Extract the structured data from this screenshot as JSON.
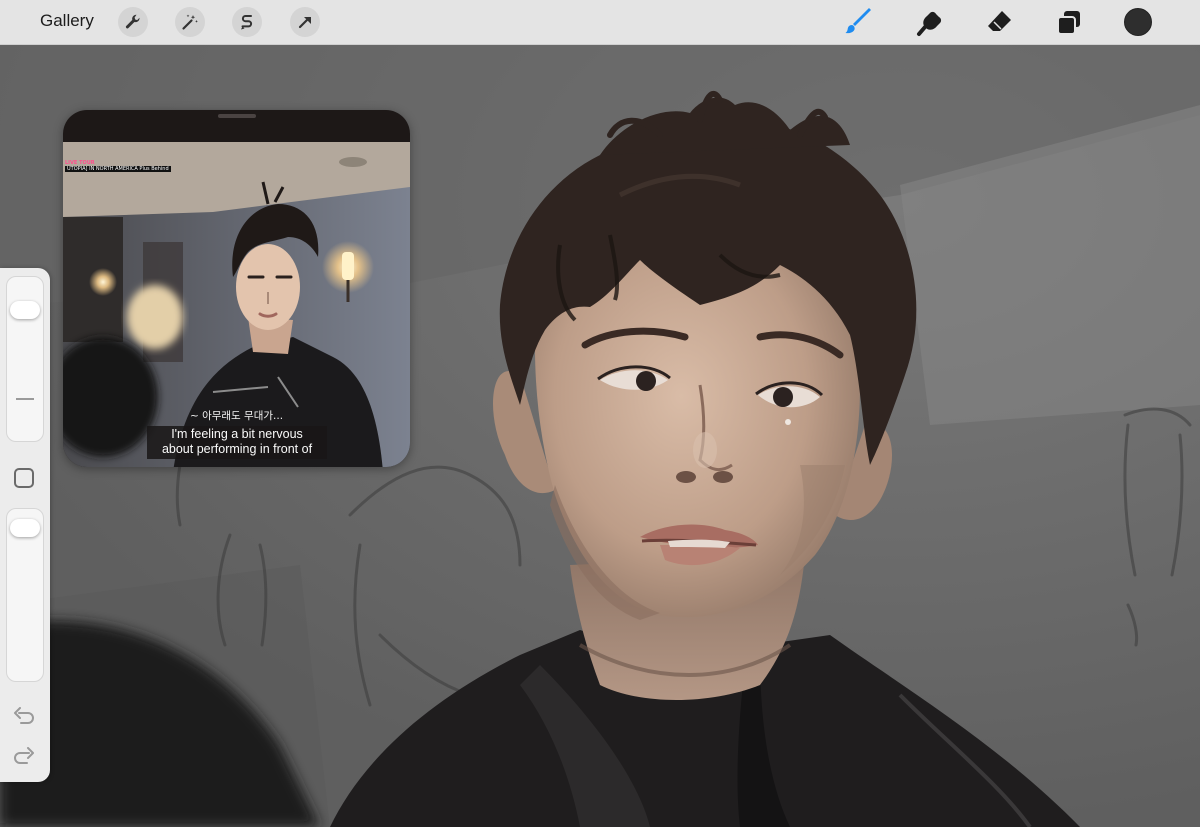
{
  "toolbar": {
    "gallery_label": "Gallery",
    "left_tools": [
      "wrench-icon",
      "magic-wand-icon",
      "selection-icon",
      "transform-arrow-icon"
    ],
    "right_tools": [
      "brush-icon",
      "smudge-icon",
      "eraser-icon",
      "layers-icon",
      "color-swatch"
    ],
    "active_tool": "brush-icon",
    "accent_color": "#1f8cf0",
    "current_color": "#2e2e2e"
  },
  "sidebar": {
    "brush_size": 0.85,
    "opacity": 0.95,
    "undo_icon": "undo-icon",
    "redo_icon": "redo-icon"
  },
  "reference": {
    "broadcast_tag": "LIVE TOUR",
    "broadcast_title": "UTOPIA] IN NORTH AMERICA Plus Behind",
    "korean_caption": "~ 아무래도 무대가...",
    "subtitle_line1": "I'm feeling a bit nervous",
    "subtitle_line2": "about performing in front of"
  }
}
